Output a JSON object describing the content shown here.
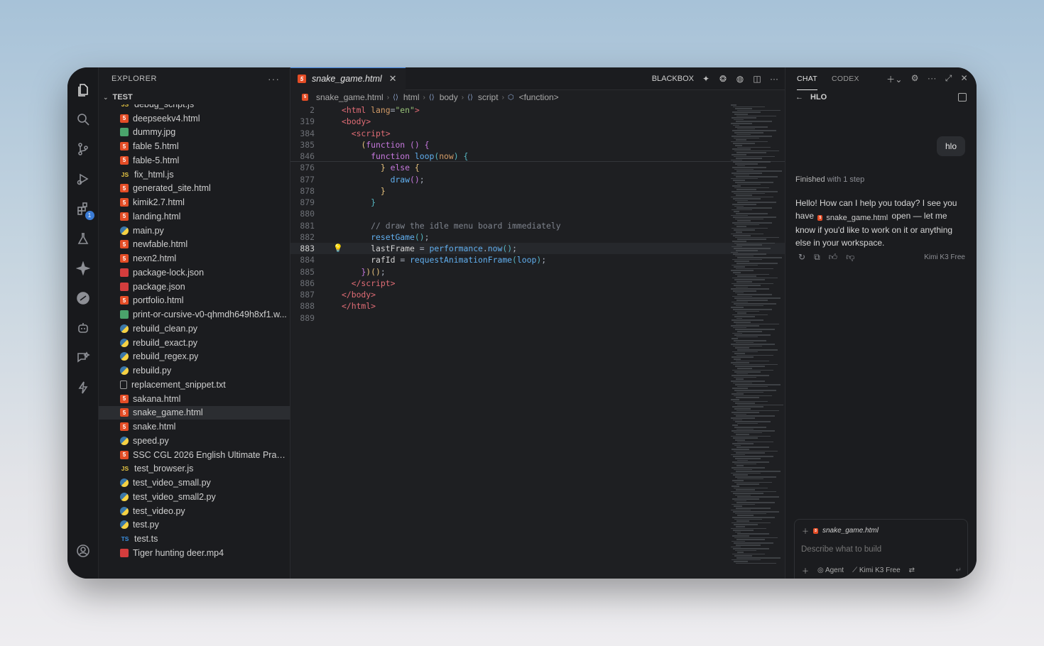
{
  "explorer": {
    "title": "EXPLORER",
    "more": "···",
    "folder": "TEST",
    "files": [
      {
        "name": "debug_script.js",
        "type": "js"
      },
      {
        "name": "deepseekv4.html",
        "type": "html"
      },
      {
        "name": "dummy.jpg",
        "type": "img"
      },
      {
        "name": "fable 5.html",
        "type": "html"
      },
      {
        "name": "fable-5.html",
        "type": "html"
      },
      {
        "name": "fix_html.js",
        "type": "js"
      },
      {
        "name": "generated_site.html",
        "type": "html"
      },
      {
        "name": "kimik2.7.html",
        "type": "html"
      },
      {
        "name": "landing.html",
        "type": "html"
      },
      {
        "name": "main.py",
        "type": "py"
      },
      {
        "name": "newfable.html",
        "type": "html"
      },
      {
        "name": "nexn2.html",
        "type": "html"
      },
      {
        "name": "package-lock.json",
        "type": "json"
      },
      {
        "name": "package.json",
        "type": "json"
      },
      {
        "name": "portfolio.html",
        "type": "html"
      },
      {
        "name": "print-or-cursive-v0-qhmdh649h8xf1.w...",
        "type": "img"
      },
      {
        "name": "rebuild_clean.py",
        "type": "py"
      },
      {
        "name": "rebuild_exact.py",
        "type": "py"
      },
      {
        "name": "rebuild_regex.py",
        "type": "py"
      },
      {
        "name": "rebuild.py",
        "type": "py"
      },
      {
        "name": "replacement_snippet.txt",
        "type": "txt"
      },
      {
        "name": "sakana.html",
        "type": "html"
      },
      {
        "name": "snake_game.html",
        "type": "html",
        "selected": true
      },
      {
        "name": "snake.html",
        "type": "html"
      },
      {
        "name": "speed.py",
        "type": "py"
      },
      {
        "name": "SSC CGL 2026 English Ultimate Practi...",
        "type": "html"
      },
      {
        "name": "test_browser.js",
        "type": "js"
      },
      {
        "name": "test_video_small.py",
        "type": "py"
      },
      {
        "name": "test_video_small2.py",
        "type": "py"
      },
      {
        "name": "test_video.py",
        "type": "py"
      },
      {
        "name": "test.py",
        "type": "py"
      },
      {
        "name": "test.ts",
        "type": "ts"
      },
      {
        "name": "Tiger hunting deer.mp4",
        "type": "vid"
      }
    ]
  },
  "editor": {
    "tab": {
      "name": "snake_game.html",
      "close": "✕"
    },
    "actions": {
      "blackbox": "BLACKBOX",
      "more": "···"
    },
    "breadcrumb": [
      "snake_game.html",
      "html",
      "body",
      "script",
      "<function>"
    ],
    "current_line": 883
  },
  "chat": {
    "tabs": [
      "CHAT",
      "CODEX"
    ],
    "title": "HLO",
    "user_message": "hlo",
    "status_prefix": "Finished",
    "status_suffix": "with 1 step",
    "reply_part1": "Hello! How can I help you today? I see you have",
    "reply_file": "snake_game.html",
    "reply_part2": "open — let me know if you'd like to work on it or anything else in your workspace.",
    "model": "Kimi K3 Free",
    "context_file": "snake_game.html",
    "input_placeholder": "Describe what to build",
    "mode": "Agent",
    "composer_model": "Kimi K3 Free"
  }
}
